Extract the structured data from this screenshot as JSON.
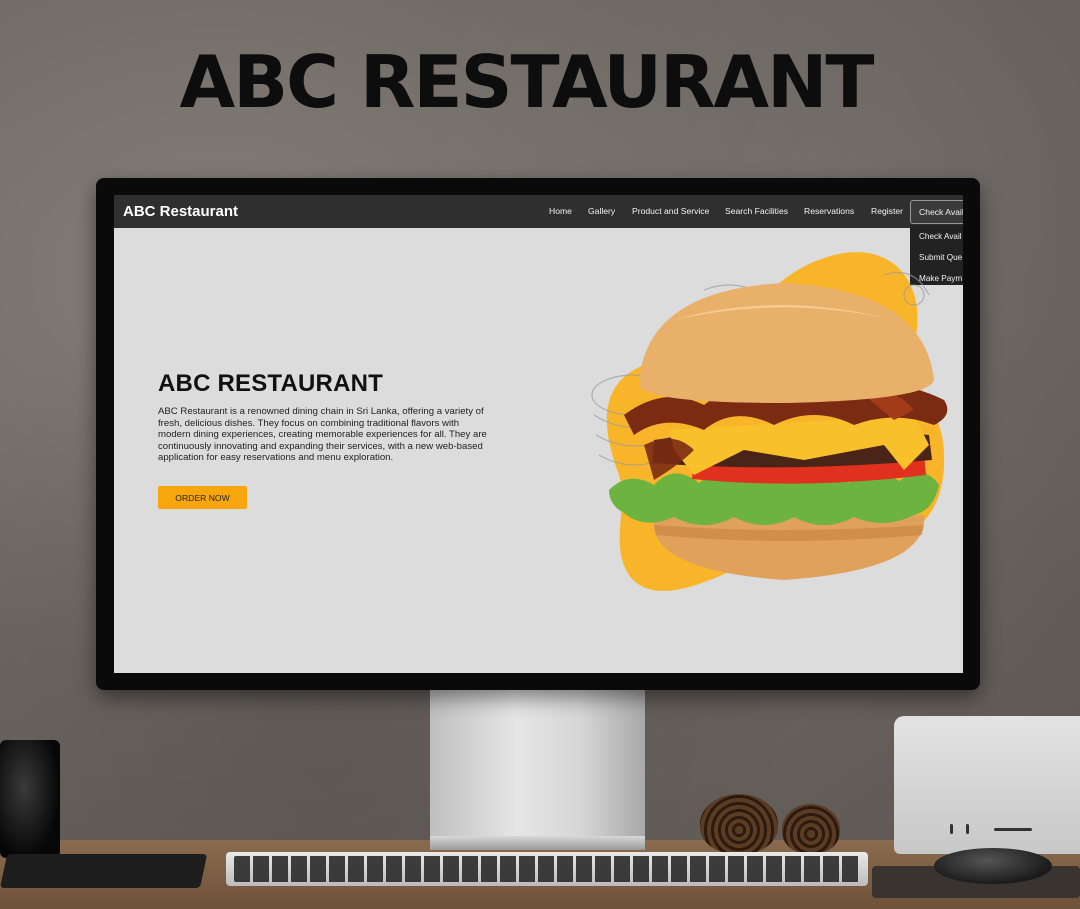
{
  "poster": {
    "title": "ABC RESTAURANT"
  },
  "site": {
    "brand": "ABC Restaurant",
    "nav": [
      {
        "label": "Home"
      },
      {
        "label": "Gallery"
      },
      {
        "label": "Product and Service"
      },
      {
        "label": "Search Facilities"
      },
      {
        "label": "Reservations"
      },
      {
        "label": "Register"
      },
      {
        "label": "Check Avail"
      }
    ],
    "dropdown": [
      {
        "label": "Check Avail"
      },
      {
        "label": "Submit Que"
      },
      {
        "label": "Make Paym"
      }
    ],
    "hero": {
      "title": "ABC RESTAURANT",
      "text": "ABC Restaurant is a renowned dining chain in Sri Lanka, offering a variety of fresh, delicious dishes. They focus on combining traditional flavors with modern dining experiences, creating memorable experiences for all. They are continuously innovating and expanding their services, with a new web-based application for easy reservations and menu exploration.",
      "cta": "ORDER NOW"
    },
    "colors": {
      "accent": "#f7a60e",
      "nav_bg": "#2f2f2f",
      "page_bg": "#dcdcdc",
      "blob": "#f9b52a"
    },
    "hero_image": "burger-image"
  }
}
